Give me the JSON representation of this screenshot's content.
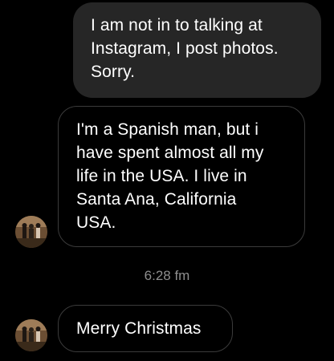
{
  "messages": {
    "sent": {
      "lines": [
        "I am not in to talking at",
        "Instagram, I post photos.",
        "Sorry."
      ]
    },
    "received_long": {
      "lines": [
        "I'm a Spanish man, but i",
        "have spent almost all my",
        "life in the USA. I live in",
        "Santa Ana, California",
        "USA."
      ]
    },
    "timestamp": "6:28 fm",
    "received_short": {
      "text": "Merry Christmas"
    }
  },
  "avatar": {
    "icon": "profile-photo",
    "colors": {
      "ring": "#c9a277",
      "dark": "#3a2a1a"
    }
  },
  "theme": {
    "background": "#000000",
    "sent_bubble": "#262626",
    "received_border": "#3b3b3b",
    "timestamp_color": "#8e8e8e"
  }
}
